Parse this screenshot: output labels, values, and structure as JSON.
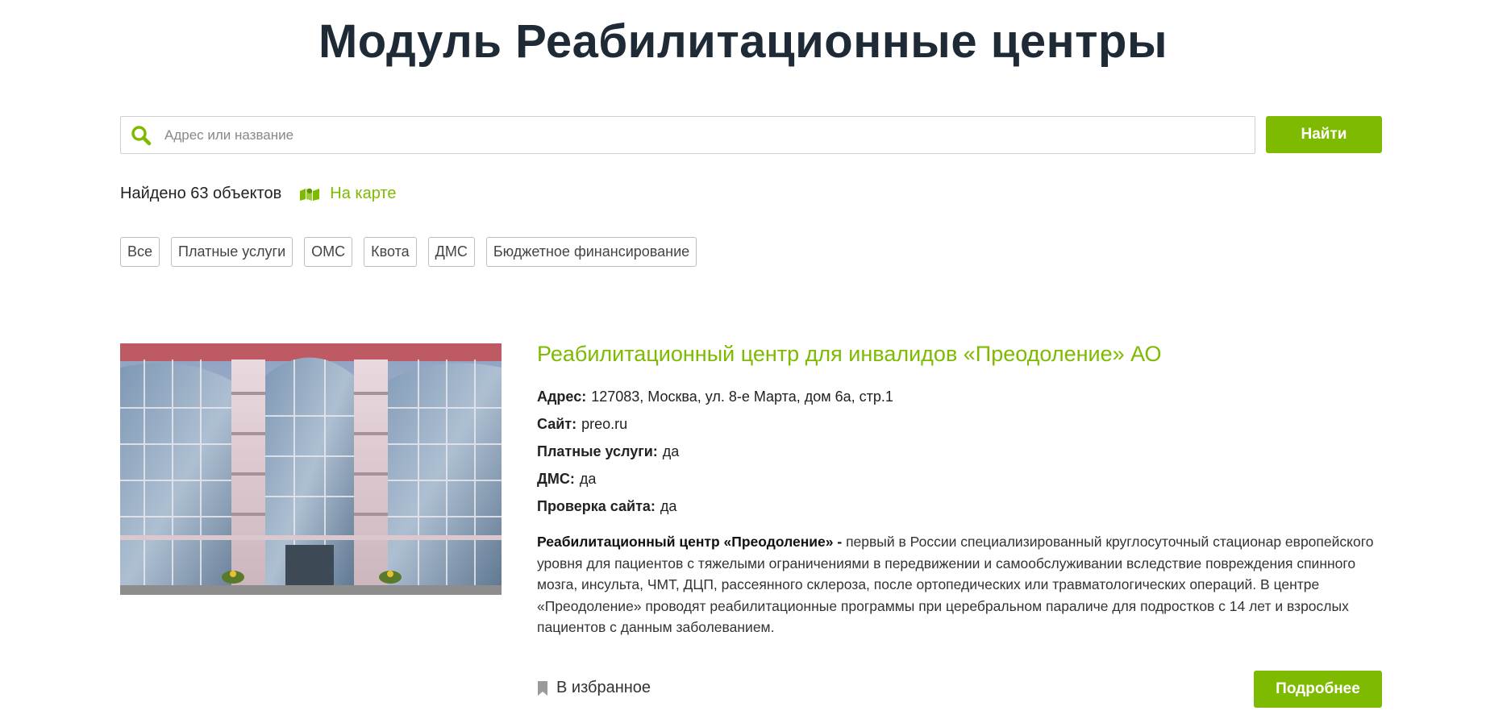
{
  "page": {
    "title": "Модуль Реабилитационные центры"
  },
  "search": {
    "placeholder": "Адрес или название",
    "value": "",
    "button_label": "Найти",
    "icon": "search-icon"
  },
  "results": {
    "count_text": "Найдено 63 объектов",
    "map_link_label": "На карте",
    "map_icon": "map-icon"
  },
  "filters": [
    "Все",
    "Платные услуги",
    "ОМС",
    "Квота",
    "ДМС",
    "Бюджетное финансирование"
  ],
  "card": {
    "title": "Реабилитационный центр для инвалидов «Преодоление» АО",
    "fields": [
      {
        "key": "Адрес:",
        "value": "127083, Москва, ул. 8-е Марта, дом 6а, стр.1"
      },
      {
        "key": "Сайт:",
        "value": "preo.ru"
      },
      {
        "key": "Платные услуги:",
        "value": "да"
      },
      {
        "key": "ДМС:",
        "value": "да"
      },
      {
        "key": "Проверка сайта:",
        "value": "да"
      }
    ],
    "description_lead": "Реабилитационный центр «Преодоление» -",
    "description_text": " первый в России специализированный круглосуточный стационар европейского уровня для пациентов с тяжелыми ограничениями в передвижении и самообслуживании вследствие повреждения спинного мозга, инсульта, ЧМТ, ДЦП, рассеянного склероза, после ортопедических или травматологических операций. В центре «Преодоление» проводят реабилитационные программы при церебральном параличе для подростков с 14 лет и взрослых пациентов с данным заболеванием.",
    "favorite_label": "В избранное",
    "favorite_icon": "bookmark-icon",
    "more_button_label": "Подробнее"
  },
  "colors": {
    "accent": "#7dba00",
    "title": "#1e2a36"
  }
}
